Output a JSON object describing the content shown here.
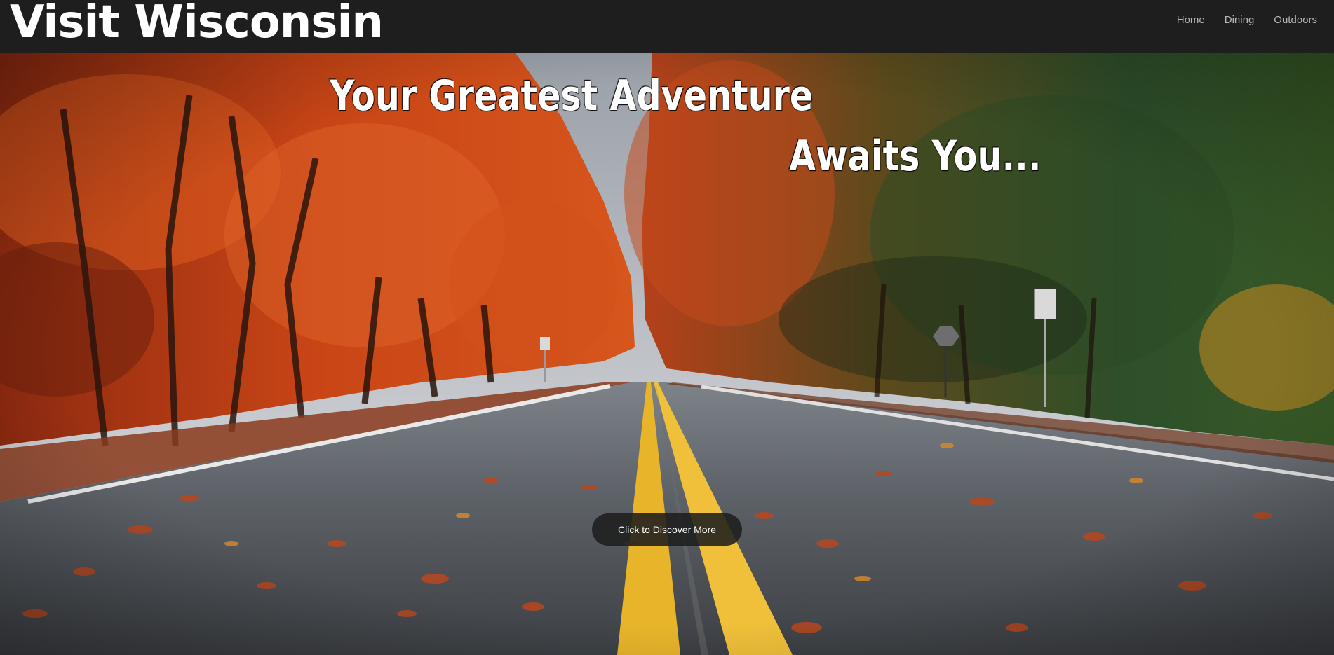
{
  "brand": {
    "name": "Visit Wisconsin"
  },
  "nav": {
    "items": [
      {
        "label": "Home"
      },
      {
        "label": "Dining"
      },
      {
        "label": "Outdoors"
      }
    ]
  },
  "hero": {
    "headline_line1": "Your Greatest Adventure",
    "headline_line2": "Awaits You...",
    "cta_label": "Click to Discover More"
  },
  "colors": {
    "nav_background": "#1e1e1e",
    "nav_link": "#b8b8b8",
    "cta_background": "#1e1e1e"
  }
}
